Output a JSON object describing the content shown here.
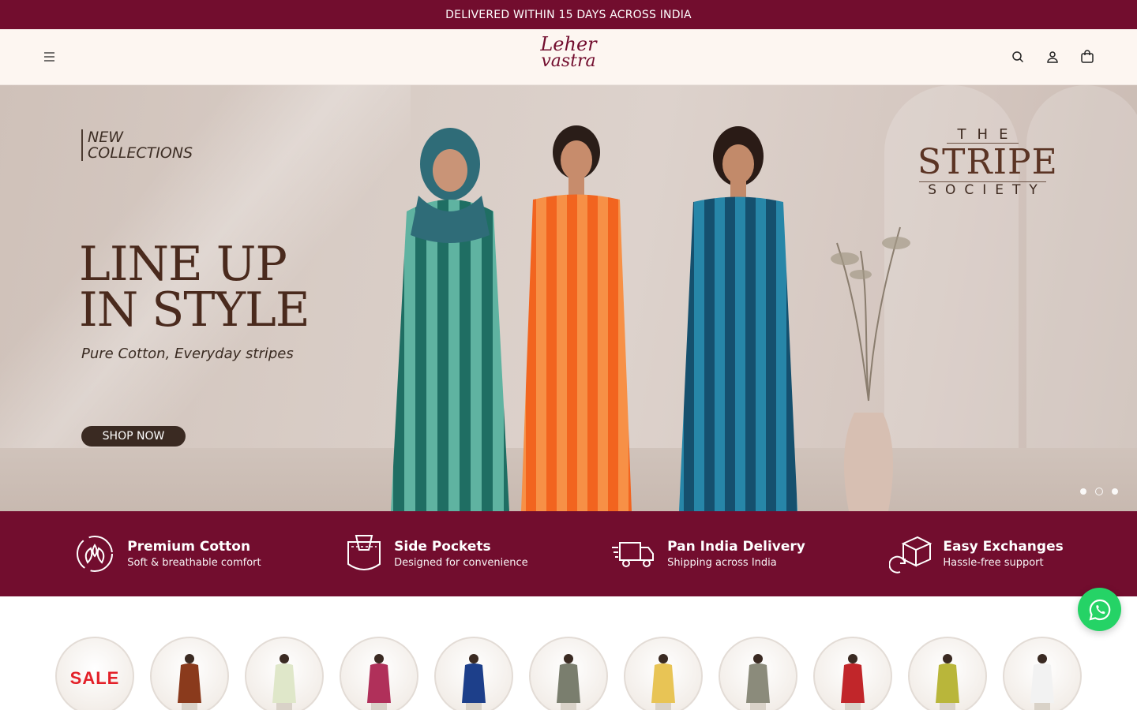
{
  "announcement": "DELIVERED WITHIN 15 DAYS ACROSS INDIA",
  "brand": {
    "line1": "Leher",
    "line2": "vastra"
  },
  "hero": {
    "tag_line1": "NEW",
    "tag_line2": "COLLECTIONS",
    "headline_line1": "LINE UP",
    "headline_line2": "IN STYLE",
    "subline": "Pure Cotton, Everyday stripes",
    "cta": "SHOP NOW",
    "collection_the": "THE",
    "collection_stripe": "STRIPE",
    "collection_society": "SOCIETY",
    "slides": 3,
    "active_slide": 2
  },
  "features": [
    {
      "title": "Premium Cotton",
      "subtitle": "Soft & breathable comfort",
      "icon": "leaf-cotton-icon"
    },
    {
      "title": "Side Pockets",
      "subtitle": "Designed for convenience",
      "icon": "pocket-icon"
    },
    {
      "title": "Pan India Delivery",
      "subtitle": "Shipping across India",
      "icon": "delivery-truck-icon"
    },
    {
      "title": "Easy Exchanges",
      "subtitle": "Hassle-free support",
      "icon": "exchange-box-icon"
    }
  ],
  "categories": {
    "sale_label": "SALE",
    "colors": [
      "#8a3a1c",
      "#dfe7c9",
      "#b0305a",
      "#1d3f8a",
      "#7a7e6e",
      "#e8c455",
      "#8b8b7b",
      "#c1262a",
      "#b9b63a",
      "#f2f2f2"
    ]
  },
  "colors": {
    "brand": "#720d2e",
    "whatsapp": "#25d366"
  }
}
